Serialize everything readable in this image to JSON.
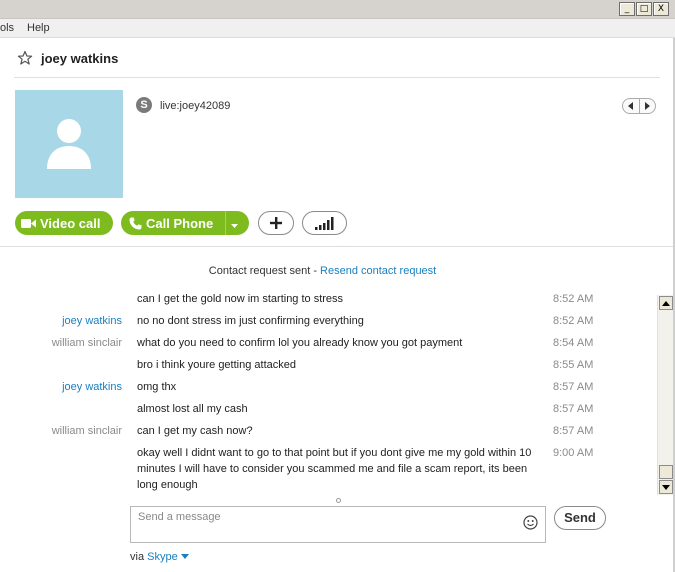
{
  "window": {
    "menu": {
      "tools_label": "ols",
      "help_label": "Help"
    },
    "controls": {
      "minimize": "_",
      "maximize": "□",
      "close": "X"
    }
  },
  "header": {
    "contact_name": "joey watkins",
    "favorite_icon": "star-icon"
  },
  "profile": {
    "skype_badge": "S",
    "skype_id": "live:joey42089"
  },
  "actions": {
    "video_call_label": "Video call",
    "call_phone_label": "Call Phone",
    "more_dots": "....",
    "accent_color": "#7dbb1e"
  },
  "conversation": {
    "request_text": "Contact request sent - ",
    "resend_link": "Resend contact request",
    "messages": [
      {
        "sender": "",
        "text": "can I get the gold now im starting to stress",
        "time": "8:52 AM"
      },
      {
        "sender": "joey watkins",
        "text": "no no dont stress im just confirming everything",
        "time": "8:52 AM"
      },
      {
        "sender": "william sinclair",
        "text": "what do you need to confirm lol you already know you got payment",
        "time": "8:54 AM"
      },
      {
        "sender": "",
        "text": "bro i think youre getting attacked",
        "time": "8:55 AM"
      },
      {
        "sender": "joey watkins",
        "text": "omg thx",
        "time": "8:57 AM"
      },
      {
        "sender": "",
        "text": "almost lost all my cash",
        "time": "8:57 AM"
      },
      {
        "sender": "william sinclair",
        "text": "can I get my cash now?",
        "time": "8:57 AM"
      },
      {
        "sender": "",
        "text": "okay well I didnt want to go to that point but if you dont give me my gold within 10 minutes I will have to consider you scammed me and file a scam report, its been long enough",
        "time": "9:00 AM"
      }
    ]
  },
  "composer": {
    "placeholder": "Send a message",
    "send_label": "Send",
    "via_prefix": "via ",
    "via_service": "Skype"
  }
}
